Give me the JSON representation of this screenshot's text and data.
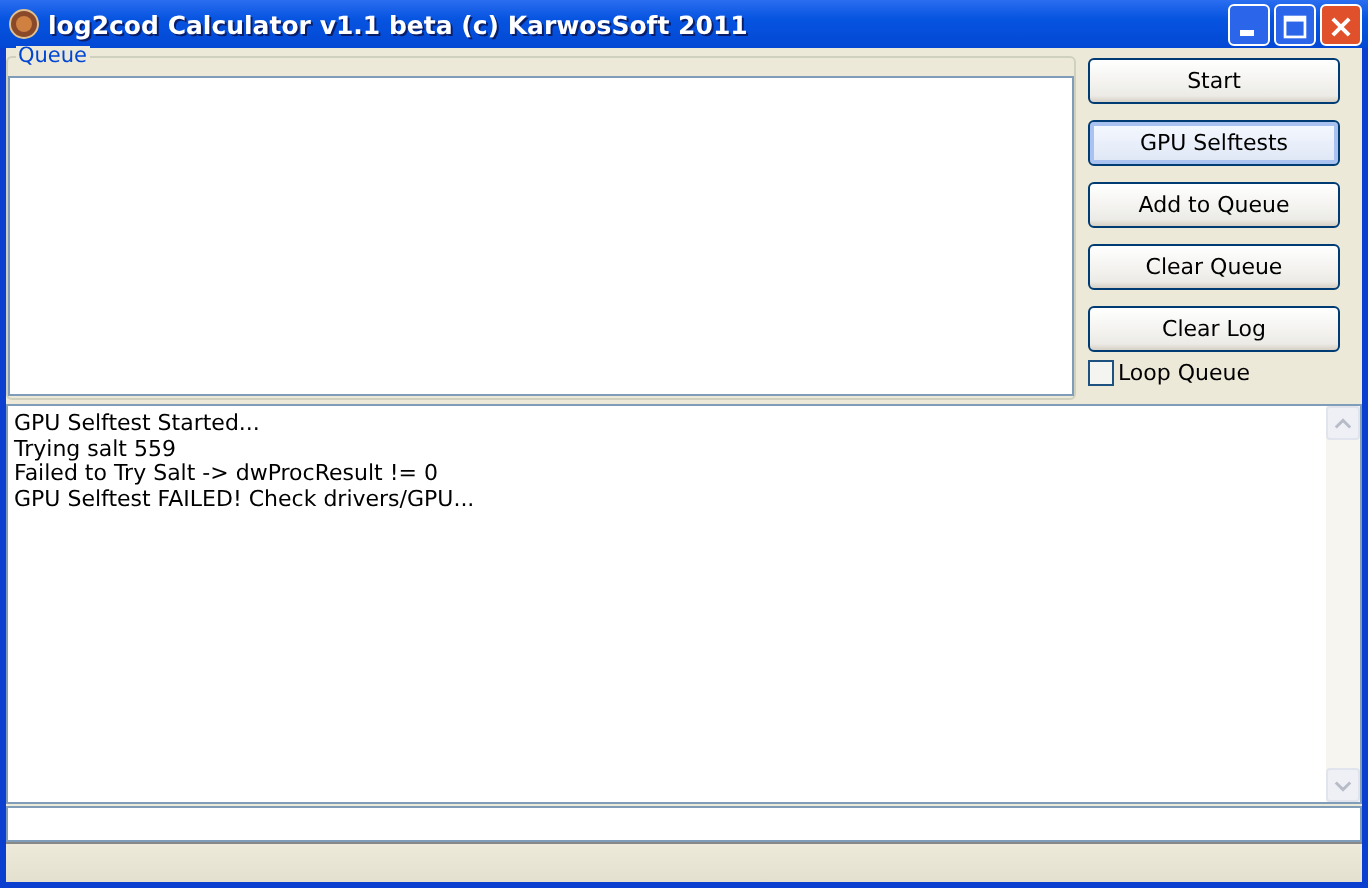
{
  "window": {
    "title": "log2cod Calculator v1.1 beta (c) KarwosSoft 2011"
  },
  "queue": {
    "label": "Queue"
  },
  "buttons": [
    {
      "label": "Start",
      "focused": false
    },
    {
      "label": "GPU Selftests",
      "focused": true
    },
    {
      "label": "Add to Queue",
      "focused": false
    },
    {
      "label": "Clear Queue",
      "focused": false
    },
    {
      "label": "Clear Log",
      "focused": false
    }
  ],
  "loop_queue": {
    "label": "Loop Queue",
    "checked": false
  },
  "log": {
    "lines": [
      "GPU Selftest Started...",
      "Trying salt 559",
      "Failed to Try Salt -> dwProcResult != 0",
      "GPU Selftest FAILED! Check drivers/GPU..."
    ]
  }
}
